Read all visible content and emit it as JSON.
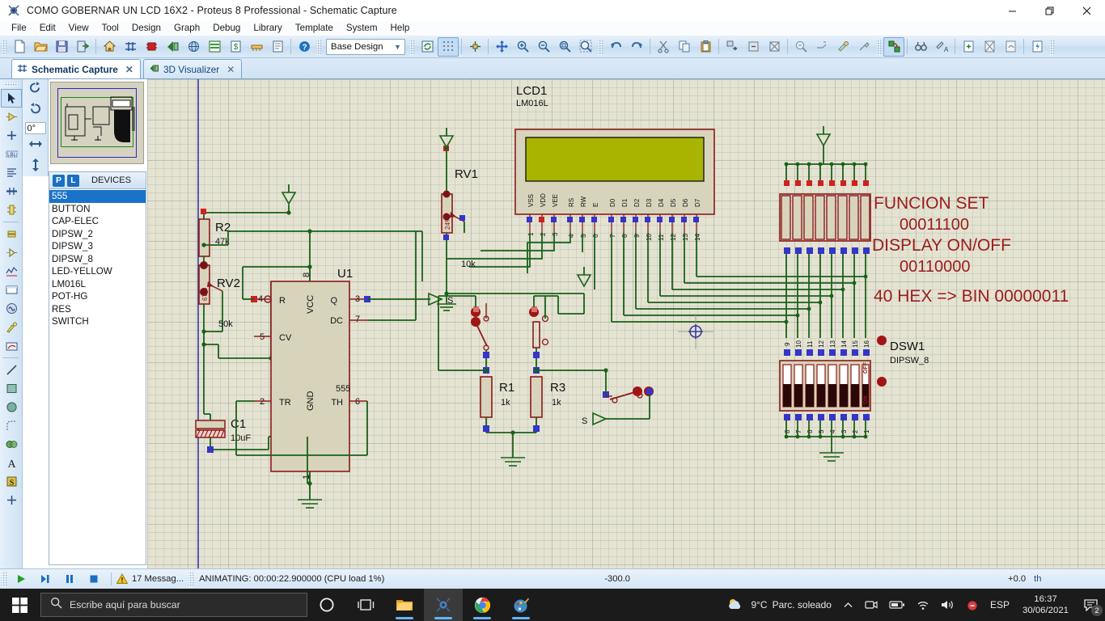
{
  "window": {
    "title": "COMO GOBERNAR UN LCD 16X2 - Proteus 8 Professional - Schematic Capture",
    "app_icon": "proteus-icon",
    "minimize": "–",
    "maximize": "❐",
    "close": "✕"
  },
  "menu": {
    "items": [
      {
        "label": "File"
      },
      {
        "label": "Edit"
      },
      {
        "label": "View"
      },
      {
        "label": "Tool"
      },
      {
        "label": "Design"
      },
      {
        "label": "Graph"
      },
      {
        "label": "Debug"
      },
      {
        "label": "Library"
      },
      {
        "label": "Template"
      },
      {
        "label": "System"
      },
      {
        "label": "Help"
      }
    ]
  },
  "toolbar": {
    "design_combo_value": "Base Design",
    "design_combo_arrow": "▼",
    "buttons": [
      {
        "name": "new-document-button",
        "icon": "new-document-icon"
      },
      {
        "name": "open-button",
        "icon": "open-folder-icon"
      },
      {
        "name": "save-button",
        "icon": "save-disk-icon"
      },
      {
        "name": "import-button",
        "icon": "import-arrow-icon"
      },
      {
        "name": "home-button",
        "icon": "home-icon"
      },
      {
        "name": "schematic-capture-button",
        "icon": "schematic-icon"
      },
      {
        "name": "pcb-layout-button",
        "icon": "chip-icon"
      },
      {
        "name": "3d-visualizer-button",
        "icon": "3d-view-icon"
      },
      {
        "name": "design-explorer-button",
        "icon": "globe-icon"
      },
      {
        "name": "bom-button",
        "icon": "spreadsheet-icon"
      },
      {
        "name": "bill-of-materials-button",
        "icon": "money-icon"
      },
      {
        "name": "cadcam-button",
        "icon": "cadcam-icon"
      },
      {
        "name": "report-button",
        "icon": "report-icon"
      },
      {
        "name": "help-button",
        "icon": "help-question-icon"
      },
      {
        "name": "refresh-button",
        "icon": "refresh-icon"
      },
      {
        "name": "toggle-grid-button",
        "icon": "grid-dots-icon"
      },
      {
        "name": "origin-button",
        "icon": "origin-crosshair-icon"
      },
      {
        "name": "pan-button",
        "icon": "pan-arrows-icon"
      },
      {
        "name": "zoom-in-button",
        "icon": "zoom-in-icon"
      },
      {
        "name": "zoom-out-button",
        "icon": "zoom-out-icon"
      },
      {
        "name": "zoom-all-button",
        "icon": "zoom-all-icon"
      },
      {
        "name": "zoom-area-button",
        "icon": "zoom-area-icon"
      },
      {
        "name": "undo-button",
        "icon": "undo-arrow-icon"
      },
      {
        "name": "redo-button",
        "icon": "redo-arrow-icon"
      },
      {
        "name": "cut-button",
        "icon": "scissors-icon"
      },
      {
        "name": "copy-button",
        "icon": "copy-icon"
      },
      {
        "name": "paste-button",
        "icon": "clipboard-icon"
      },
      {
        "name": "block-copy-button",
        "icon": "block-copy-icon"
      },
      {
        "name": "block-move-button",
        "icon": "block-move-icon"
      },
      {
        "name": "block-delete-button",
        "icon": "block-delete-icon"
      },
      {
        "name": "pick-device-button",
        "icon": "pick-device-icon"
      },
      {
        "name": "make-device-button",
        "icon": "make-device-icon"
      },
      {
        "name": "packaging-tool-button",
        "icon": "packaging-icon"
      },
      {
        "name": "decompose-button",
        "icon": "decompose-icon"
      },
      {
        "name": "wire-autorouter-button",
        "icon": "autorouter-icon"
      },
      {
        "name": "search-tag-button",
        "icon": "binoculars-icon"
      },
      {
        "name": "property-assignment-button",
        "icon": "property-tool-icon"
      },
      {
        "name": "new-sheet-button",
        "icon": "new-sheet-icon"
      },
      {
        "name": "remove-sheet-button",
        "icon": "remove-sheet-icon"
      },
      {
        "name": "exit-sheet-button",
        "icon": "exit-sheet-icon"
      },
      {
        "name": "bill-report-button",
        "icon": "power-sheet-icon"
      }
    ]
  },
  "tabs": [
    {
      "label": "Schematic Capture",
      "icon": "schematic-icon",
      "close": "✕",
      "selected": true
    },
    {
      "label": "3D Visualizer",
      "icon": "3d-view-icon",
      "close": "✕",
      "selected": false
    }
  ],
  "left_tools": [
    {
      "name": "selection-mode-tool",
      "icon": "arrow-cursor-icon",
      "selected": true
    },
    {
      "name": "component-mode-tool",
      "icon": "component-arrow-icon",
      "selected": false
    },
    {
      "name": "junction-dot-tool",
      "icon": "junction-dot-icon",
      "selected": false
    },
    {
      "name": "wire-label-tool",
      "icon": "label-lbl-icon",
      "selected": false
    },
    {
      "name": "text-script-tool",
      "icon": "text-lines-icon",
      "selected": false
    },
    {
      "name": "buses-tool",
      "icon": "bus-icon",
      "selected": false
    },
    {
      "name": "subcircuit-tool",
      "icon": "subcircuit-icon",
      "selected": false
    },
    {
      "name": "terminals-mode-tool",
      "icon": "terminal-icon",
      "selected": false
    },
    {
      "name": "device-pins-tool",
      "icon": "device-pin-icon",
      "selected": false
    },
    {
      "name": "graph-mode-tool",
      "icon": "graph-chart-icon",
      "selected": false
    },
    {
      "name": "tape-recorder-tool",
      "icon": "tape-recorder-icon",
      "selected": false
    },
    {
      "name": "generator-mode-tool",
      "icon": "generator-sine-icon",
      "selected": false
    },
    {
      "name": "voltage-probe-tool",
      "icon": "probe-pen-icon",
      "selected": false
    },
    {
      "name": "virtual-instrument-tool",
      "icon": "instrument-icon",
      "selected": false
    },
    {
      "name": "2d-line-tool",
      "icon": "line-icon",
      "selected": false
    },
    {
      "name": "2d-box-tool",
      "icon": "box-icon",
      "selected": false
    },
    {
      "name": "2d-circle-tool",
      "icon": "circle-icon",
      "selected": false
    },
    {
      "name": "2d-arc-tool",
      "icon": "arc-icon",
      "selected": false
    },
    {
      "name": "2d-path-tool",
      "icon": "path-icon",
      "selected": false
    },
    {
      "name": "2d-text-tool",
      "icon": "text-a-icon",
      "selected": false
    },
    {
      "name": "symbol-tool",
      "icon": "symbol-s-icon",
      "selected": false
    },
    {
      "name": "marker-tool",
      "icon": "marker-cross-icon",
      "selected": false
    }
  ],
  "orientation": {
    "rotate_cw": "rotate-clockwise-icon",
    "rotate_ccw": "rotate-counterclockwise-icon",
    "angle": "0°",
    "mirror_h": "mirror-horizontal-icon",
    "mirror_v": "mirror-vertical-icon"
  },
  "devices_panel": {
    "pick_label": "P",
    "library_label": "L",
    "title": "DEVICES",
    "items": [
      {
        "label": "555",
        "selected": true
      },
      {
        "label": "BUTTON",
        "selected": false
      },
      {
        "label": "CAP-ELEC",
        "selected": false
      },
      {
        "label": "DIPSW_2",
        "selected": false
      },
      {
        "label": "DIPSW_3",
        "selected": false
      },
      {
        "label": "DIPSW_8",
        "selected": false
      },
      {
        "label": "LED-YELLOW",
        "selected": false
      },
      {
        "label": "LM016L",
        "selected": false
      },
      {
        "label": "POT-HG",
        "selected": false
      },
      {
        "label": "RES",
        "selected": false
      },
      {
        "label": "SWITCH",
        "selected": false
      }
    ]
  },
  "schematic": {
    "lcd": {
      "ref": "LCD1",
      "part": "LM016L",
      "pins": [
        "VSS",
        "VDD",
        "VEE",
        "RS",
        "RW",
        "E",
        "D0",
        "D1",
        "D2",
        "D3",
        "D4",
        "D5",
        "D6",
        "D7"
      ],
      "pin_numbers": [
        "1",
        "2",
        "3",
        "4",
        "5",
        "6",
        "7",
        "8",
        "9",
        "10",
        "11",
        "12",
        "13",
        "14"
      ],
      "screen_color": "#a8b400"
    },
    "rv1": {
      "ref": "RV1",
      "value": "10k",
      "percent": "24%"
    },
    "rv2": {
      "ref": "RV2",
      "value": "50k",
      "percent": "67%"
    },
    "r2": {
      "ref": "R2",
      "value": "47k"
    },
    "r1": {
      "ref": "R1",
      "value": "1k"
    },
    "r3": {
      "ref": "R3",
      "value": "1k"
    },
    "c1": {
      "ref": "C1",
      "value": "10uF"
    },
    "u1": {
      "ref": "U1",
      "part": "555",
      "pins": [
        {
          "num": "4",
          "label": "R"
        },
        {
          "num": "8",
          "label": "VCC"
        },
        {
          "num": "3",
          "label": "Q"
        },
        {
          "num": "7",
          "label": "DC"
        },
        {
          "num": "5",
          "label": "CV"
        },
        {
          "num": "2",
          "label": "TR"
        },
        {
          "num": "1",
          "label": "GND"
        },
        {
          "num": "6",
          "label": "TH"
        }
      ]
    },
    "dsw1": {
      "ref": "DSW1",
      "part": "DIPSW_8",
      "on_label": "ON",
      "off_label": "OFF",
      "top_pins": [
        "16",
        "15",
        "14",
        "13",
        "12",
        "11",
        "10",
        "9"
      ],
      "bottom_pins": [
        "8",
        "7",
        "6",
        "5",
        "4",
        "3",
        "2",
        "1"
      ]
    },
    "terminal_s_top": "S",
    "terminal_s_bottom": "S",
    "annotation": {
      "line1": "FUNCION SET",
      "line2": "00011100",
      "line3": "DISPLAY  ON/OFF",
      "line4": "00110000",
      "line5": "40 HEX => BIN 00000011",
      "color": "#9b1b1b"
    },
    "colors": {
      "wire": "#196119",
      "body_outline": "#8b1a1a",
      "body_fill": "#d8d4bc",
      "pin_blue": "#3535c8",
      "pin_red": "#d02020",
      "canvas": "#e4e3d2"
    }
  },
  "statusbar": {
    "play": "play-button",
    "step": "step-button",
    "pause": "pause-button",
    "stop": "stop-button",
    "messages": "17 Messag...",
    "warning_icon": "warning-triangle-icon",
    "animating": "ANIMATING: 00:00:22.900000 (CPU load 1%)",
    "coord_x": "-300.0",
    "coord_y": "+0.0",
    "coord_suffix": "th"
  },
  "taskbar": {
    "start": "windows-start-icon",
    "search_placeholder": "Escribe aquí para buscar",
    "search_icon": "search-icon",
    "apps": [
      {
        "name": "cortana-icon",
        "running": false,
        "active": false
      },
      {
        "name": "task-view-icon",
        "running": false,
        "active": false
      },
      {
        "name": "file-explorer-icon",
        "running": true,
        "active": false
      },
      {
        "name": "proteus-icon",
        "running": true,
        "active": true
      },
      {
        "name": "chrome-icon",
        "running": true,
        "active": false
      },
      {
        "name": "paint-icon",
        "running": true,
        "active": false
      }
    ],
    "weather": {
      "icon": "partly-cloudy-icon",
      "temp": "9°C",
      "desc": "Parc. soleado"
    },
    "tray": [
      {
        "name": "show-hidden-icons",
        "glyph": "∧"
      },
      {
        "name": "camera-icon",
        "glyph": ""
      },
      {
        "name": "battery-icon",
        "glyph": ""
      },
      {
        "name": "wifi-icon",
        "glyph": ""
      },
      {
        "name": "volume-icon",
        "glyph": ""
      },
      {
        "name": "mute-notification-icon",
        "glyph": ""
      }
    ],
    "language": "ESP",
    "time": "16:37",
    "date": "30/06/2021",
    "notifications_count": "2"
  }
}
